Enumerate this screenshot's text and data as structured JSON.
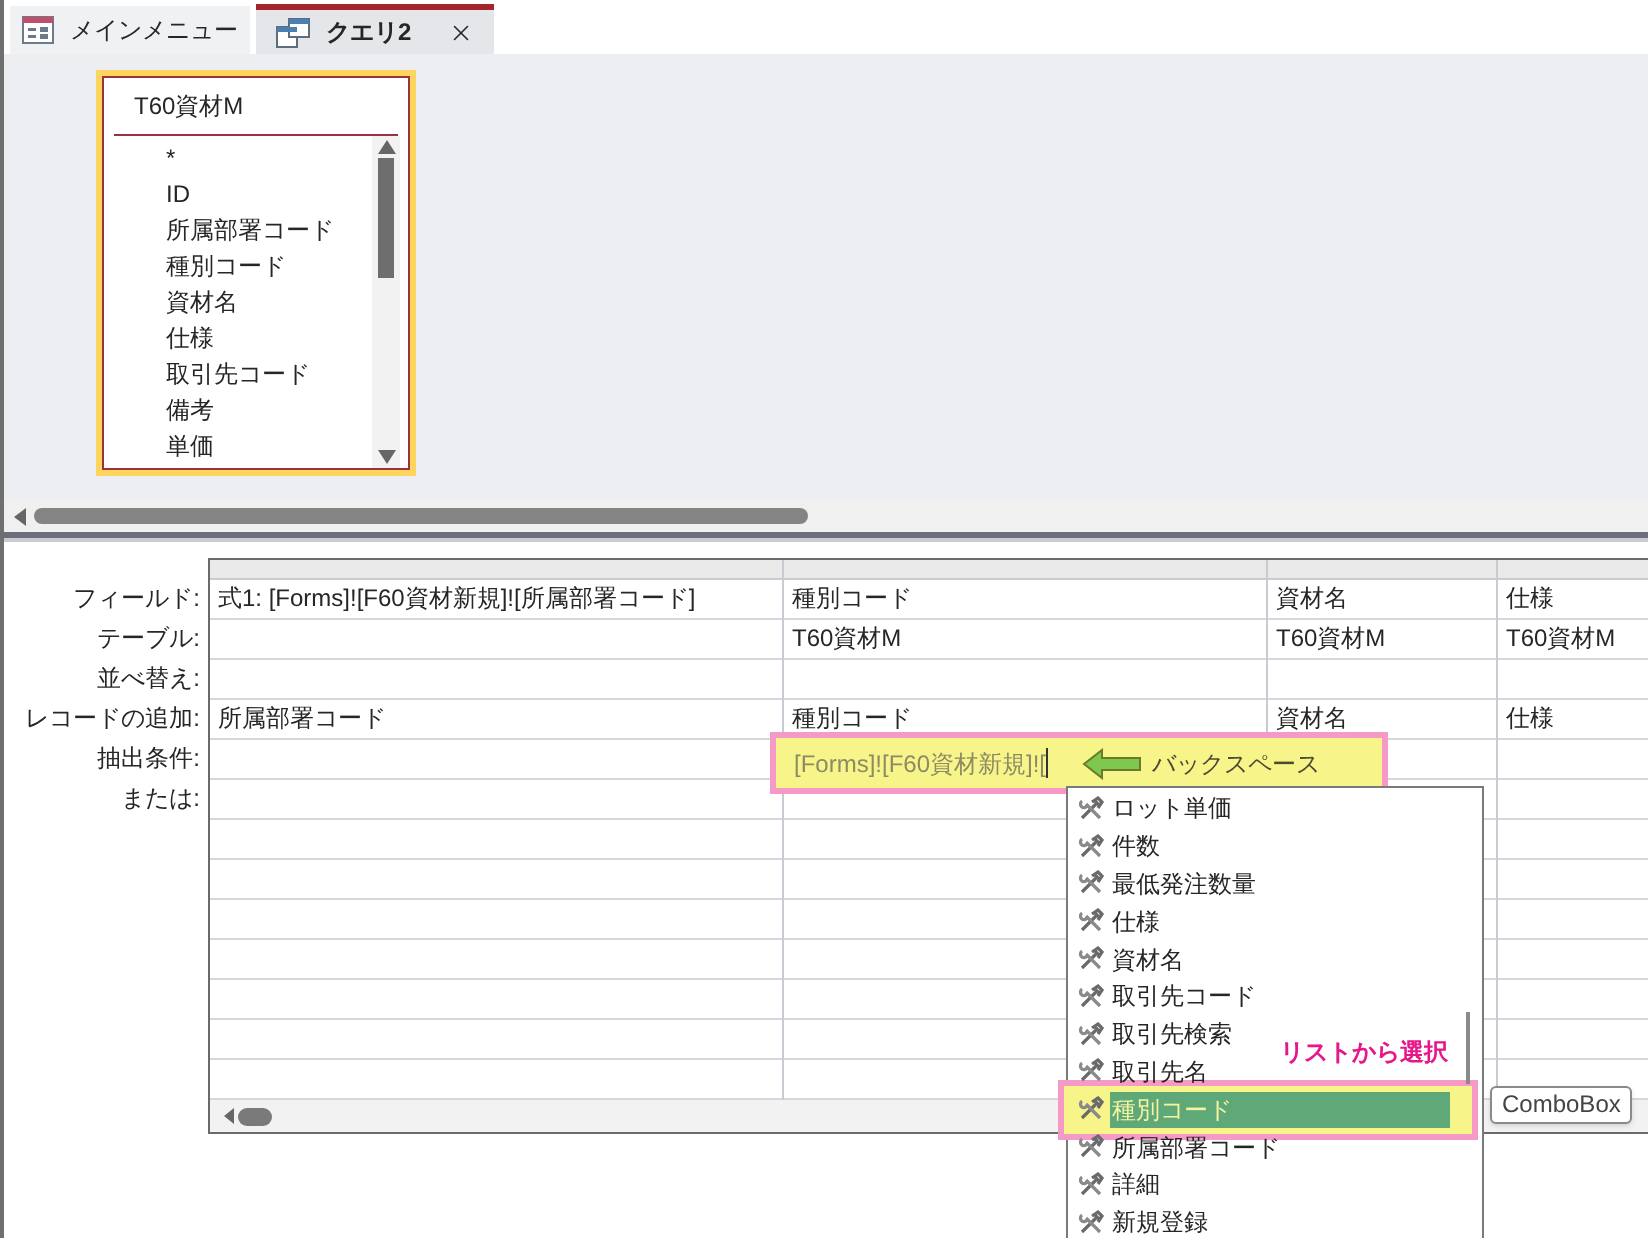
{
  "tabs": [
    {
      "label": "メインメニュー",
      "kind": "form",
      "selected": false,
      "closable": false
    },
    {
      "label": "クエリ2",
      "kind": "query",
      "selected": true,
      "closable": true
    }
  ],
  "table_box": {
    "title": "T60資材M",
    "fields": [
      "*",
      "ID",
      "所属部署コード",
      "種別コード",
      "資材名",
      "仕様",
      "取引先コード",
      "備考",
      "単価"
    ]
  },
  "grid": {
    "row_labels": [
      "フィールド:",
      "テーブル:",
      "並べ替え:",
      "レコードの追加:",
      "抽出条件:",
      "または:"
    ],
    "columns": [
      {
        "field": "式1: [Forms]![F60資材新規]![所属部署コード]",
        "append_to": "所属部署コード"
      },
      {
        "field": "種別コード",
        "table": "T60資材M",
        "append_to": "種別コード",
        "criteria": "[Forms]![F60資材新規]!["
      },
      {
        "field": "資材名",
        "table": "T60資材M",
        "append_to": "資材名"
      },
      {
        "field": "仕様",
        "table": "T60資材M",
        "append_to": "仕様"
      }
    ]
  },
  "backspace_note": "バックスペース",
  "select_note": "リストから選択",
  "dropdown": {
    "items": [
      {
        "label": "ロット単価",
        "selected": false
      },
      {
        "label": "件数",
        "selected": false
      },
      {
        "label": "最低発注数量",
        "selected": false
      },
      {
        "label": "仕様",
        "selected": false
      },
      {
        "label": "資材名",
        "selected": false
      },
      {
        "label": "取引先コード",
        "selected": false
      },
      {
        "label": "取引先検索",
        "selected": false
      },
      {
        "label": "取引先名",
        "selected": false
      },
      {
        "label": "種別コード",
        "selected": true
      },
      {
        "label": "所属部署コード",
        "selected": false
      },
      {
        "label": "詳細",
        "selected": false
      },
      {
        "label": "新規登録",
        "selected": false
      }
    ]
  },
  "tooltip": "ComboBox"
}
